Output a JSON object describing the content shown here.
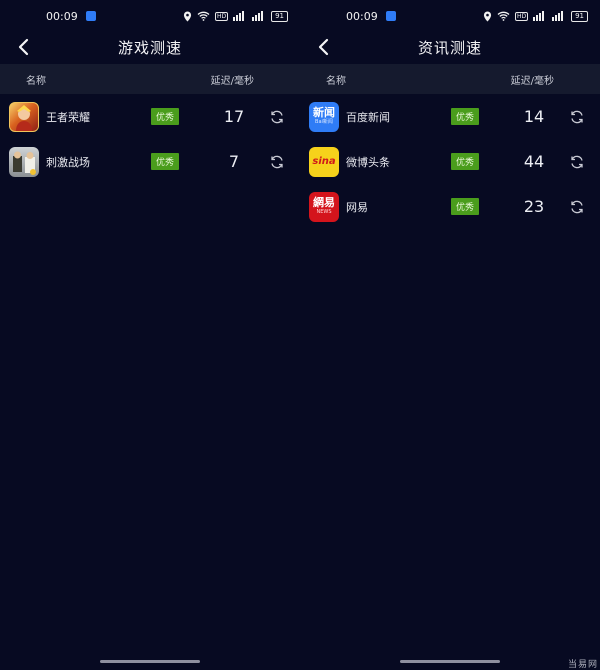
{
  "left": {
    "status": {
      "time": "00:09",
      "battery": "91",
      "hd": "HD"
    },
    "title": "游戏测速",
    "columns": {
      "name": "名称",
      "latency": "延迟/毫秒"
    },
    "rows": [
      {
        "name": "王者荣耀",
        "badge": "优秀",
        "latency": "17",
        "icon": "honor-of-kings-icon"
      },
      {
        "name": "刺激战场",
        "badge": "优秀",
        "latency": "7",
        "icon": "pubg-icon"
      }
    ]
  },
  "right": {
    "status": {
      "time": "00:09",
      "battery": "91",
      "hd": "HD"
    },
    "title": "资讯测速",
    "columns": {
      "name": "名称",
      "latency": "延迟/毫秒"
    },
    "rows": [
      {
        "name": "百度新闻",
        "badge": "优秀",
        "latency": "14",
        "icon": "baidu-news-icon",
        "icon_text": "新闻",
        "icon_sub": "Bai新闻"
      },
      {
        "name": "微博头条",
        "badge": "优秀",
        "latency": "44",
        "icon": "sina-weibo-icon",
        "icon_text": "sina"
      },
      {
        "name": "网易",
        "badge": "优秀",
        "latency": "23",
        "icon": "netease-icon",
        "icon_text": "網易",
        "icon_sub": "NEWS"
      }
    ]
  },
  "colors": {
    "background": "#070a22",
    "header_bar": "#151a2e",
    "badge": "#4a9d1c"
  },
  "watermark": "当易网"
}
